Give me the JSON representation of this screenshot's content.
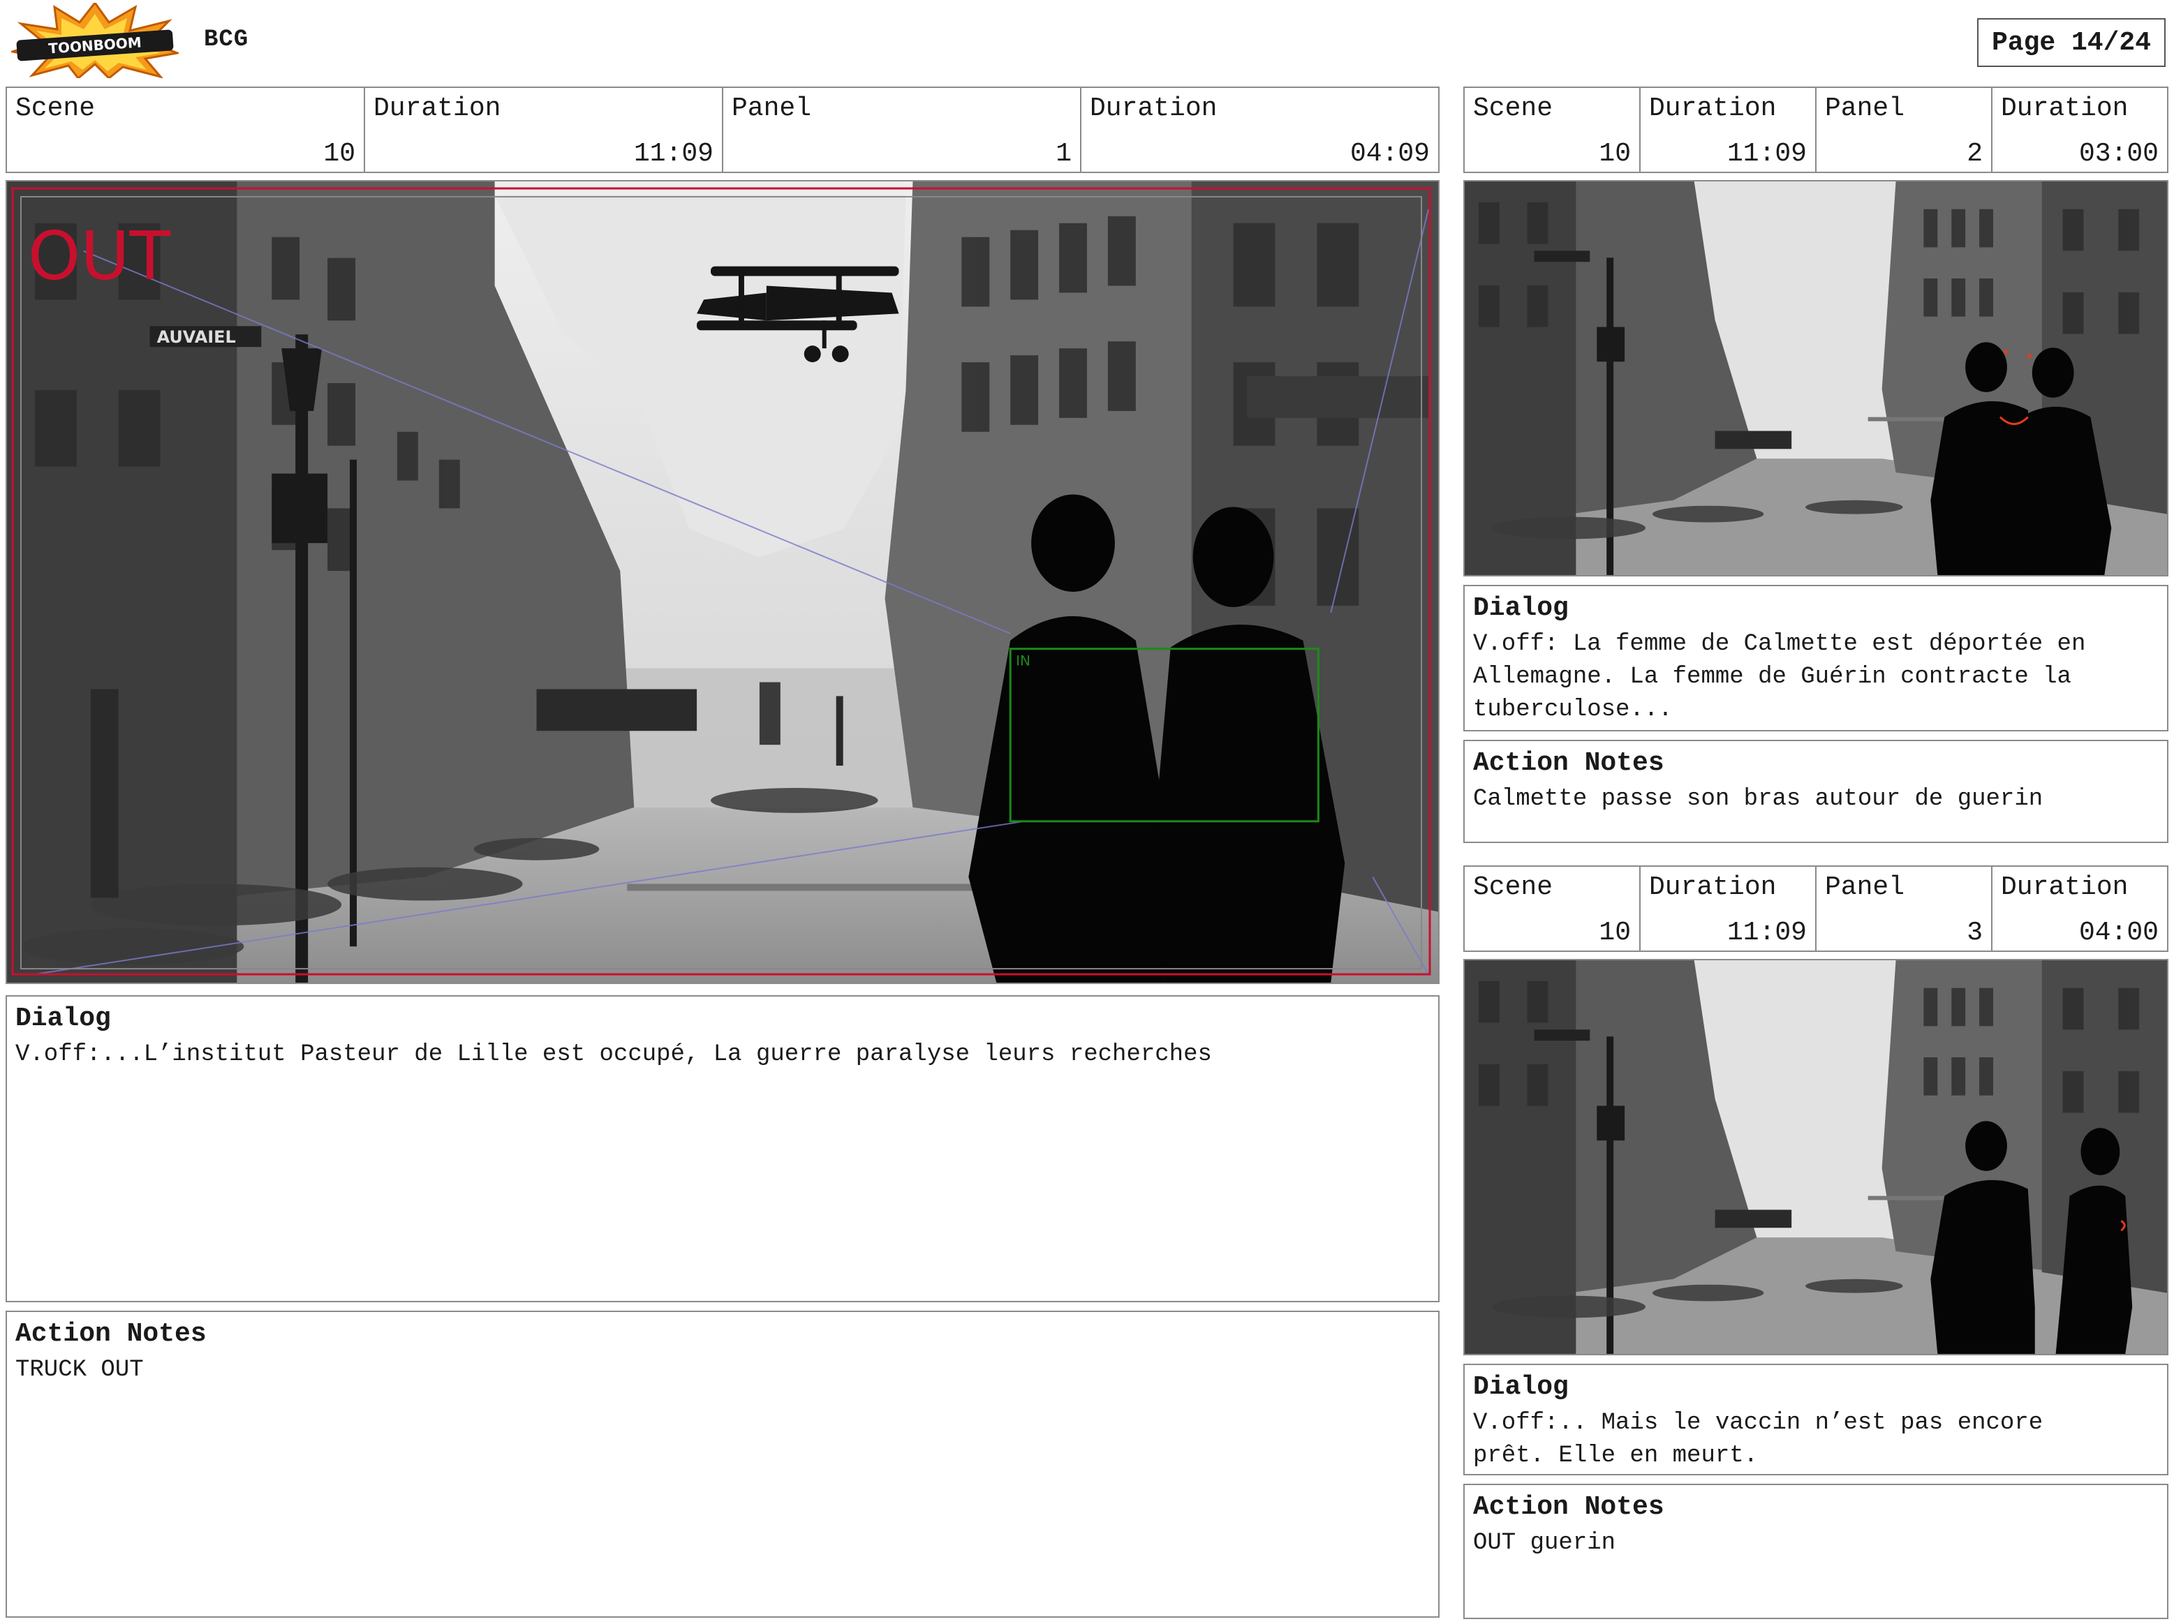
{
  "header": {
    "logo_text": "TOONBOOM",
    "project": "BCG",
    "page": "Page 14/24"
  },
  "labels": {
    "scene": "Scene",
    "duration": "Duration",
    "panel": "Panel",
    "dialog": "Dialog",
    "action_notes": "Action Notes"
  },
  "panels": [
    {
      "scene": "10",
      "scene_duration": "11:09",
      "panel": "1",
      "panel_duration": "04:09",
      "overlay_out": "OUT",
      "overlay_in": "IN",
      "dialog": "V.off:...L’institut Pasteur de Lille est occupé, La guerre paralyse leurs recherches",
      "action_notes": "TRUCK OUT"
    },
    {
      "scene": "10",
      "scene_duration": "11:09",
      "panel": "2",
      "panel_duration": "03:00",
      "dialog": "V.off: La femme de Calmette est déportée en\nAllemagne. La femme de Guérin contracte la\ntuberculose...",
      "action_notes": "Calmette passe son bras autour de guerin"
    },
    {
      "scene": "10",
      "scene_duration": "11:09",
      "panel": "3",
      "panel_duration": "04:00",
      "dialog": "V.off:.. Mais le vaccin n’est pas encore\nprêt. Elle en meurt.",
      "action_notes": "OUT guerin"
    }
  ],
  "colors": {
    "frame_out": "#c8102e",
    "frame_in": "#1a8a1a",
    "motion_path": "#7a7acc",
    "logo_orange": "#f59a1b"
  }
}
